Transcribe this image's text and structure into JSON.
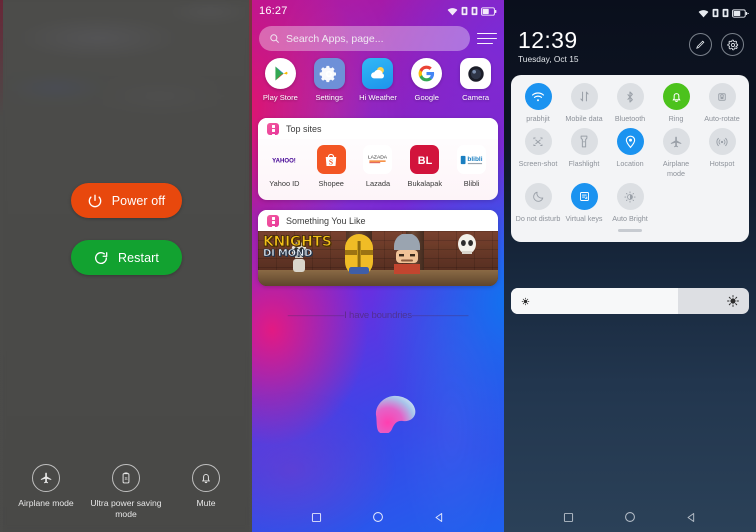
{
  "power_menu": {
    "buttons": [
      {
        "label": "Power off",
        "icon": "power-icon",
        "color": "#e8480d"
      },
      {
        "label": "Restart",
        "icon": "restart-icon",
        "color": "#12a230"
      }
    ],
    "bottom_actions": [
      {
        "label": "Airplane mode",
        "icon": "airplane-icon"
      },
      {
        "label": "Ultra power saving mode",
        "icon": "battery-saver-icon"
      },
      {
        "label": "Mute",
        "icon": "bell-icon"
      }
    ]
  },
  "home": {
    "status_bar": {
      "time": "16:27",
      "icons": [
        "wifi-icon",
        "sim1-signal-icon",
        "sim2-signal-icon",
        "battery-icon"
      ]
    },
    "search": {
      "placeholder": "Search Apps, page...",
      "icon": "search-icon"
    },
    "menu_icon": "hamburger-menu-icon",
    "apps": [
      {
        "label": "Play Store",
        "icon": "play-store-icon"
      },
      {
        "label": "Settings",
        "icon": "settings-gear-icon"
      },
      {
        "label": "Hi Weather",
        "icon": "weather-icon"
      },
      {
        "label": "Google",
        "icon": "google-icon"
      },
      {
        "label": "Camera",
        "icon": "camera-icon"
      }
    ],
    "top_sites": {
      "title": "Top sites",
      "items": [
        {
          "label": "Yahoo ID",
          "icon": "yahoo-icon"
        },
        {
          "label": "Shopee",
          "icon": "shopee-icon"
        },
        {
          "label": "Lazada",
          "icon": "lazada-icon"
        },
        {
          "label": "Bukalapak",
          "icon": "bukalapak-icon"
        },
        {
          "label": "Blibli",
          "icon": "blibli-icon"
        }
      ]
    },
    "something_you_like": {
      "title": "Something You Like",
      "banner": {
        "title_line1": "KNIGHTS",
        "title_line2": "DI MOND"
      }
    },
    "wallpaper_text": "——————I have boundries——————",
    "nav": [
      {
        "icon": "recents-square-icon"
      },
      {
        "icon": "home-circle-icon"
      },
      {
        "icon": "back-triangle-icon"
      }
    ]
  },
  "quick_settings": {
    "status_bar": {
      "icons": [
        "wifi-icon",
        "sim1-signal-icon",
        "sim2-signal-icon",
        "battery-charging-icon"
      ]
    },
    "clock": "12:39",
    "date": "Tuesday, Oct 15",
    "actions": [
      {
        "icon": "pencil-edit-icon",
        "name": "edit-button"
      },
      {
        "icon": "gear-icon",
        "name": "settings-button"
      }
    ],
    "tiles": [
      {
        "label": "prabhjit",
        "icon": "wifi-icon",
        "state": "on-blue"
      },
      {
        "label": "Mobile data",
        "icon": "mobile-data-icon",
        "state": "off"
      },
      {
        "label": "Bluetooth",
        "icon": "bluetooth-icon",
        "state": "off"
      },
      {
        "label": "Ring",
        "icon": "bell-icon",
        "state": "on-green"
      },
      {
        "label": "Auto-rotate",
        "icon": "auto-rotate-icon",
        "state": "off"
      },
      {
        "label": "Screen-shot",
        "icon": "screenshot-icon",
        "state": "off"
      },
      {
        "label": "Flashlight",
        "icon": "flashlight-icon",
        "state": "off"
      },
      {
        "label": "Location",
        "icon": "location-pin-icon",
        "state": "on-blue"
      },
      {
        "label": "Airplane mode",
        "icon": "airplane-icon",
        "state": "off"
      },
      {
        "label": "Hotspot",
        "icon": "hotspot-icon",
        "state": "off"
      },
      {
        "label": "Do not disturb",
        "icon": "moon-icon",
        "state": "off"
      },
      {
        "label": "Virtual keys",
        "icon": "virtual-keys-icon",
        "state": "on-blue"
      },
      {
        "label": "Auto Bright",
        "icon": "auto-bright-icon",
        "state": "off"
      }
    ],
    "brightness": {
      "value_percent": 70,
      "low_icon": "brightness-low-icon",
      "high_icon": "brightness-high-icon"
    },
    "nav": [
      {
        "icon": "recents-square-icon"
      },
      {
        "icon": "home-circle-icon"
      },
      {
        "icon": "back-triangle-icon"
      }
    ]
  },
  "colors": {
    "accent_blue": "#1b93f0",
    "accent_green": "#4cc21c",
    "power_off": "#e8480d",
    "restart": "#12a230"
  }
}
